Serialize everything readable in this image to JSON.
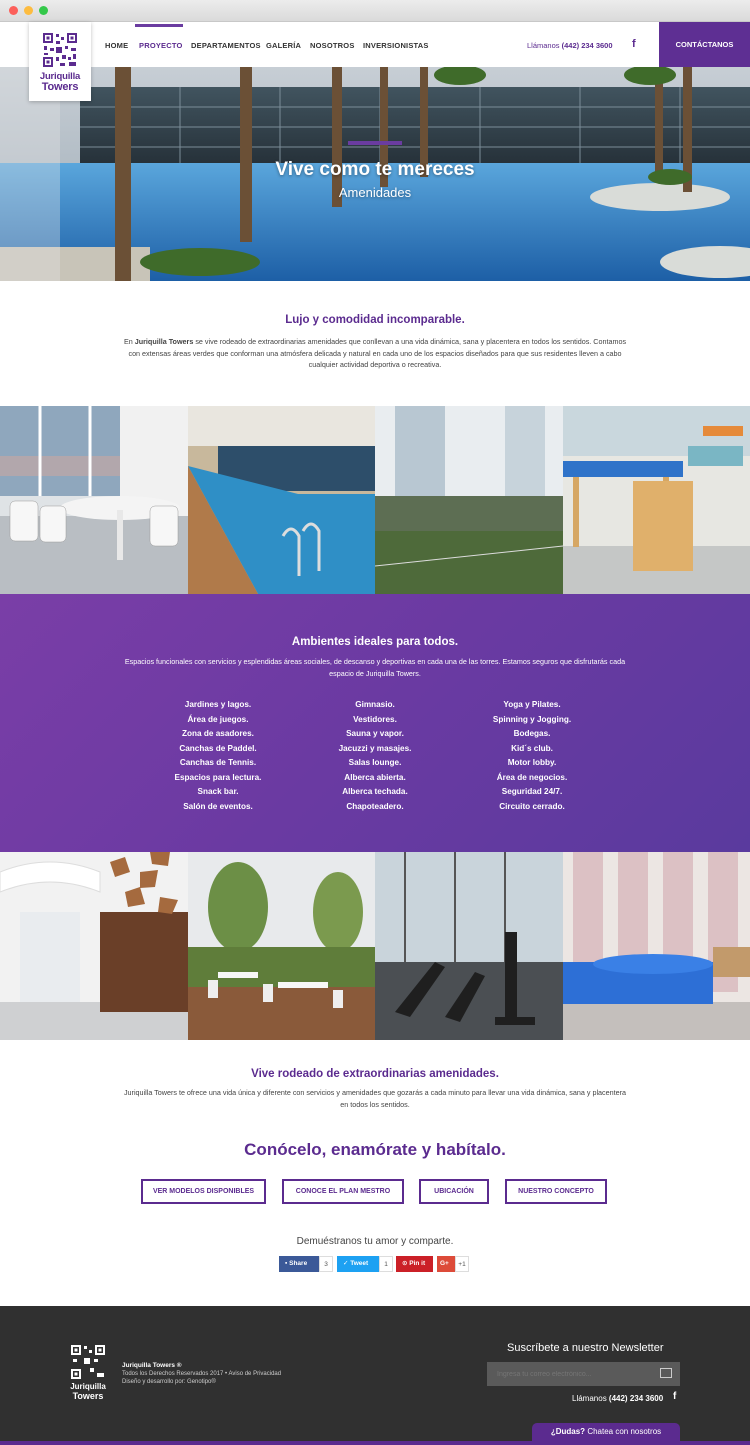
{
  "nav": {
    "items": [
      "HOME",
      "PROYECTO",
      "DEPARTAMENTOS",
      "GALERÍA",
      "NOSOTROS",
      "INVERSIONISTAS"
    ],
    "active_index": 1,
    "phone_label": "Llámanos",
    "phone_number": "(442) 234 3600",
    "facebook_icon": "f",
    "contact_button": "CONTÁCTANOS"
  },
  "logo": {
    "line1": "Juriquilla",
    "line2": "Towers"
  },
  "hero": {
    "title": "Vive como te mereces",
    "subtitle": "Amenidades"
  },
  "intro": {
    "heading": "Lujo y comodidad incomparable.",
    "brand": "Juriquilla Towers",
    "prefix": "En",
    "text": "se vive rodeado de extraordinarias amenidades que conllevan a una vida dinámica, sana y placentera en todos los sentidos. Contamos con extensas áreas verdes que conforman una atmósfera delicada y natural en cada uno de los espacios diseñados para que sus residentes lleven a cabo cualquier actividad deportiva o recreativa."
  },
  "amenities": {
    "heading": "Ambientes ideales para todos.",
    "text": "Espacios funcionales con servicios y esplendidas áreas sociales, de descanso y deportivas en cada una de las torres. Estamos seguros que disfrutarás cada espacio de Juriquilla Towers.",
    "col1": [
      "Jardines y lagos.",
      "Área de juegos.",
      "Zona de asadores.",
      "Canchas de Paddel.",
      "Canchas de Tennis.",
      "Espacios para lectura.",
      "Snack bar.",
      "Salón de eventos."
    ],
    "col2": [
      "Gimnasio.",
      "Vestidores.",
      "Sauna y vapor.",
      "Jacuzzi y masajes.",
      "Salas lounge.",
      "Alberca abierta.",
      "Alberca techada.",
      "Chapoteadero."
    ],
    "col3": [
      "Yoga y Pilates.",
      "Spinning y Jogging.",
      "Bodegas.",
      "Kid´s club.",
      "Motor lobby.",
      "Área de negocios.",
      "Seguridad 24/7.",
      "Circuito cerrado."
    ]
  },
  "outro": {
    "heading": "Vive rodeado de extraordinarias amenidades.",
    "text": "Juriquilla Towers te ofrece una vida única y diferente con servicios y amenidades que gozarás a cada minuto para llevar una vida dinámica, sana y placentera en todos los sentidos."
  },
  "cta": {
    "heading": "Conócelo, enamórate y habítalo.",
    "buttons": [
      "VER MODELOS DISPONIBLES",
      "CONOCE EL PLAN MESTRO",
      "UBICACIÓN",
      "NUESTRO CONCEPTO"
    ]
  },
  "share": {
    "heading": "Demuéstranos tu amor y comparte.",
    "facebook": "Share",
    "facebook_count": "3",
    "twitter": "Tweet",
    "twitter_count": "1",
    "pinterest": "Pin it",
    "google": "G+",
    "google_count": "+1"
  },
  "footer": {
    "name": "Juriquilla Towers ®",
    "line1": "Todos los Derechos Reservados 2017 • Aviso de Privacidad",
    "line2": "Diseño y desarrollo por: Genotipo®",
    "newsletter_heading": "Suscríbete a nuestro Newsletter",
    "newsletter_placeholder": "Ingresa tu correo electrónico...",
    "phone_label": "Llámanos",
    "phone_number": "(442) 234 3600",
    "facebook_icon": "f"
  },
  "chat": {
    "question": "¿Dudas?",
    "text": "Chatea con nosotros"
  },
  "colors": {
    "brand": "#5b2b8f",
    "footer_bg": "#303030"
  }
}
